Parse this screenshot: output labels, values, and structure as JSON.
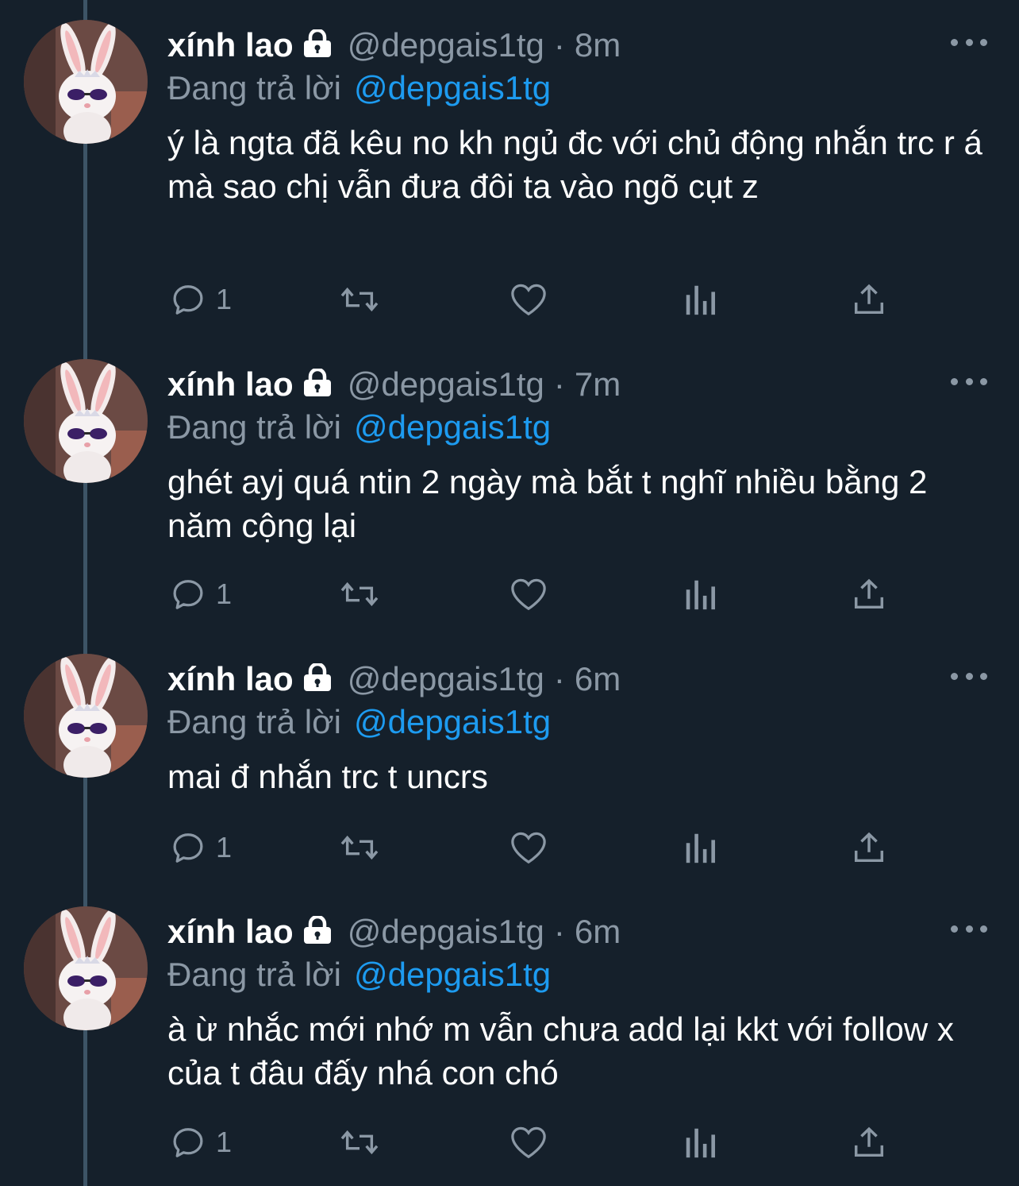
{
  "colors": {
    "background": "#15202b",
    "name": "#ffffff",
    "secondary": "#8b98a5",
    "mention": "#1d9bf0",
    "thread_line": "#3d5466"
  },
  "tweets": [
    {
      "name": "xính lao",
      "handle": "@depgais1tg",
      "separator": "·",
      "time": "8m",
      "replying_label": "Đang trả lời",
      "mention": "@depgais1tg",
      "text": "ý là ngta đã kêu no kh ngủ đc với chủ động nhắn trc r á mà sao chị vẫn đưa đôi ta vào ngõ cụt z",
      "reply_count": "1"
    },
    {
      "name": "xính lao",
      "handle": "@depgais1tg",
      "separator": "·",
      "time": "7m",
      "replying_label": "Đang trả lời",
      "mention": "@depgais1tg",
      "text": "ghét ayj quá ntin 2 ngày mà bắt t nghĩ nhiều bằng 2 năm cộng lại",
      "reply_count": "1"
    },
    {
      "name": "xính lao",
      "handle": "@depgais1tg",
      "separator": "·",
      "time": "6m",
      "replying_label": "Đang trả lời",
      "mention": "@depgais1tg",
      "text": "mai đ nhắn trc t uncrs",
      "reply_count": "1"
    },
    {
      "name": "xính lao",
      "handle": "@depgais1tg",
      "separator": "·",
      "time": "6m",
      "replying_label": "Đang trả lời",
      "mention": "@depgais1tg",
      "text": "à ừ nhắc mới nhớ m vẫn chưa add lại kkt với follow x của t đâu đấy nhá con chó",
      "reply_count": "1"
    }
  ]
}
